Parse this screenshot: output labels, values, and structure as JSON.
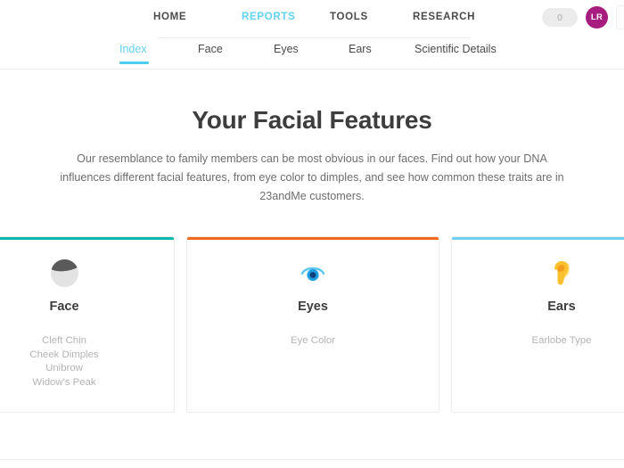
{
  "header": {
    "nav_items": [
      {
        "label": "HOME",
        "active": false
      },
      {
        "label": "REPORTS",
        "active": true
      },
      {
        "label": "TOOLS",
        "active": false
      },
      {
        "label": "RESEARCH",
        "active": false
      }
    ],
    "cart_count": "0",
    "avatar_initials": "LR",
    "active_color": "#63d2f2"
  },
  "tabs": [
    {
      "label": "Index",
      "active": true
    },
    {
      "label": "Face",
      "active": false
    },
    {
      "label": "Eyes",
      "active": false
    },
    {
      "label": "Ears",
      "active": false
    },
    {
      "label": "Scientific Details",
      "active": false
    }
  ],
  "hero": {
    "title": "Your Facial Features",
    "description": "Our resemblance to family members can be most obvious in our faces. Find out how your DNA influences different facial features, from eye color to dimples, and see how common these traits are in 23andMe customers."
  },
  "cards": [
    {
      "title": "Face",
      "icon": "face-icon",
      "accent_color": "#0ab9ac",
      "traits": [
        "Cleft Chin",
        "Cheek Dimples",
        "Unibrow",
        "Widow's Peak"
      ]
    },
    {
      "title": "Eyes",
      "icon": "eye-icon",
      "accent_color": "#f4671f",
      "traits": [
        "Eye Color"
      ]
    },
    {
      "title": "Ears",
      "icon": "ear-icon",
      "accent_color": "#6ecff0",
      "traits": [
        "Earlobe Type"
      ]
    }
  ]
}
